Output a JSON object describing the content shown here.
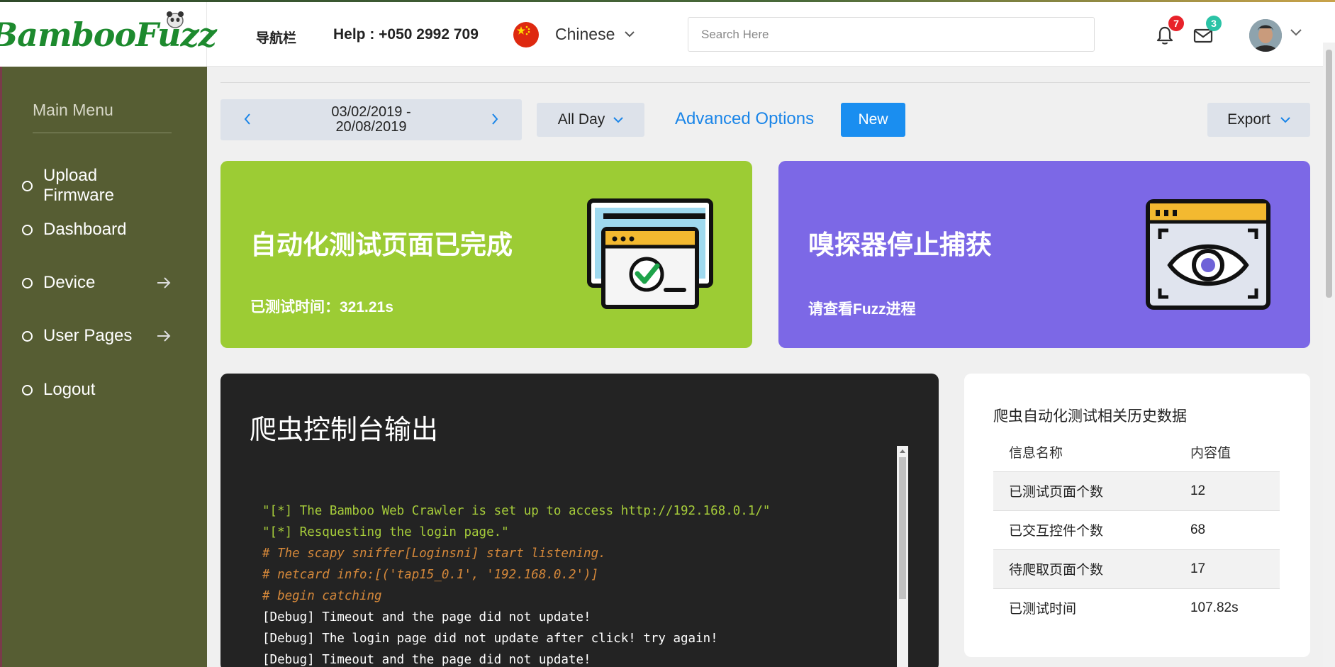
{
  "header": {
    "logo": "BambooFuzz",
    "nav_label": "导航栏",
    "help": "Help : +050 2992 709",
    "language": "Chinese",
    "search_placeholder": "Search Here",
    "notifications_count": "7",
    "messages_count": "3"
  },
  "sidebar": {
    "title": "Main Menu",
    "items": [
      {
        "label": "Upload Firmware",
        "has_arrow": false
      },
      {
        "label": "Dashboard",
        "has_arrow": false
      },
      {
        "label": "Device",
        "has_arrow": true
      },
      {
        "label": "User Pages",
        "has_arrow": true
      },
      {
        "label": "Logout",
        "has_arrow": false
      }
    ]
  },
  "toolbar": {
    "date_range_line1": "03/02/2019 -",
    "date_range_line2": "20/08/2019",
    "period": "All Day",
    "advanced": "Advanced Options",
    "new": "New",
    "export": "Export"
  },
  "cards": {
    "green": {
      "title": "自动化测试页面已完成",
      "subtitle": "已测试时间：321.21s",
      "color": "#9ccc34"
    },
    "purple": {
      "title": "嗅探器停止捕获",
      "subtitle": "请查看Fuzz进程",
      "color": "#7c68e6"
    }
  },
  "console": {
    "title": "爬虫控制台输出",
    "lines": [
      {
        "text": "\"[*] The Bamboo Web Crawler is set up to access http://192.168.0.1/\"",
        "kind": "str"
      },
      {
        "text": "\"[*] Resquesting the login page.\"",
        "kind": "str"
      },
      {
        "text": "# The scapy sniffer[Loginsni] start listening.",
        "kind": "cmt"
      },
      {
        "text": "# netcard info:[('tap15_0.1', '192.168.0.2')]",
        "kind": "cmt"
      },
      {
        "text": "# begin catching",
        "kind": "cmt"
      },
      {
        "text": "[Debug] Timeout and the page did not update!",
        "kind": "dbg"
      },
      {
        "text": "[Debug] The login page did not update after click! try again!",
        "kind": "dbg"
      },
      {
        "text": "[Debug] Timeout and the page did not update!",
        "kind": "dbg"
      }
    ]
  },
  "history": {
    "title": "爬虫自动化测试相关历史数据",
    "columns": [
      "信息名称",
      "内容值"
    ],
    "rows": [
      [
        "已测试页面个数",
        "12"
      ],
      [
        "已交互控件个数",
        "68"
      ],
      [
        "待爬取页面个数",
        "17"
      ],
      [
        "已测试时间",
        "107.82s"
      ]
    ]
  },
  "colors": {
    "accent_blue": "#1a8ef0",
    "sidebar_bg": "#565d33",
    "badge_red": "#e8222a",
    "badge_teal": "#2bc3a6"
  },
  "icons": {
    "bell": "bell-icon",
    "mail": "mail-icon",
    "chevron": "chevron-down-icon",
    "arrow_right": "arrow-right-icon"
  }
}
